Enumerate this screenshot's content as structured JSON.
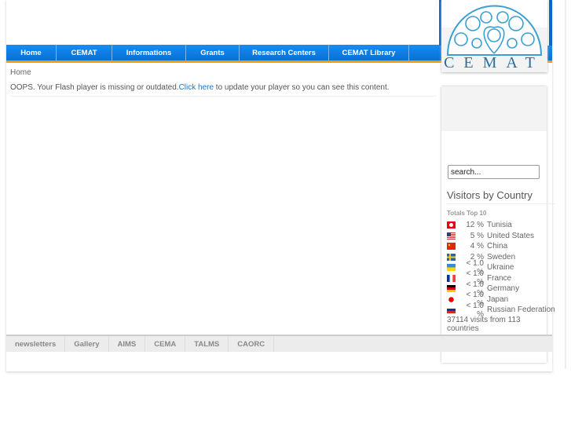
{
  "nav": [
    "Home",
    "CEMAT",
    "Informations",
    "Grants",
    "Research Centers",
    "CEMAT Library"
  ],
  "logo_text": "CEMAT",
  "breadcrumb": "Home",
  "flash": {
    "before": "OOPS. Your Flash player is missing or outdated.",
    "link": "Click here",
    "after": " to update your player so you can see this content."
  },
  "search": {
    "value": "search..."
  },
  "visitors": {
    "title": "Visitors by Country",
    "totals": "Totals Top 10",
    "rows": [
      {
        "pct": "12 %",
        "country": "Tunisia",
        "flag": "tunisia"
      },
      {
        "pct": "5 %",
        "country": "United States",
        "flag": "usa"
      },
      {
        "pct": "4 %",
        "country": "China",
        "flag": "china"
      },
      {
        "pct": "2 %",
        "country": "Sweden",
        "flag": "sweden"
      },
      {
        "pct": "< 1.0 %",
        "country": "Ukraine",
        "flag": "ukraine"
      },
      {
        "pct": "< 1.0 %",
        "country": "France",
        "flag": "france"
      },
      {
        "pct": "< 1.0 %",
        "country": "Germany",
        "flag": "germany"
      },
      {
        "pct": "< 1.0 %",
        "country": "Japan",
        "flag": "japan"
      },
      {
        "pct": "< 1.0 %",
        "country": "Russian Federation",
        "flag": "russia"
      }
    ],
    "summary": "37114 visits from 113 countries"
  },
  "footer": [
    "newsletters",
    "Gallery",
    "AIMS",
    "CEMA",
    "TALMS",
    "CAORC"
  ]
}
